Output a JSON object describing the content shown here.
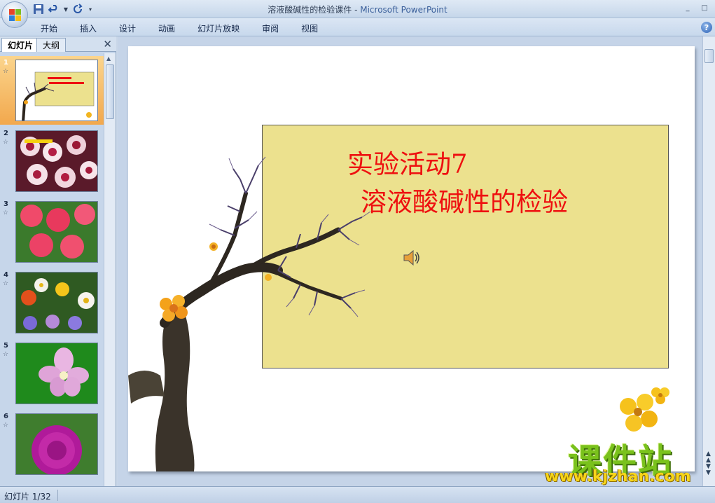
{
  "titlebar": {
    "document": "溶液酸碱性的检验课件",
    "separator": " - ",
    "app": "Microsoft PowerPoint",
    "minimize": "_",
    "maximize": "□"
  },
  "ribbon": {
    "tabs": [
      {
        "label": "开始"
      },
      {
        "label": "插入"
      },
      {
        "label": "设计"
      },
      {
        "label": "动画"
      },
      {
        "label": "幻灯片放映"
      },
      {
        "label": "审阅"
      },
      {
        "label": "视图"
      }
    ],
    "help": "?"
  },
  "left_pane": {
    "tab_slides": "幻灯片",
    "tab_outline": "大纲",
    "close": "✕",
    "thumbnails": [
      {
        "number": "1",
        "star": "☆",
        "selected": true
      },
      {
        "number": "2",
        "star": "☆",
        "selected": false
      },
      {
        "number": "3",
        "star": "☆",
        "selected": false
      },
      {
        "number": "4",
        "star": "☆",
        "selected": false
      },
      {
        "number": "5",
        "star": "☆",
        "selected": false
      },
      {
        "number": "6",
        "star": "☆",
        "selected": false
      }
    ]
  },
  "slide": {
    "title_line1": "实验活动7",
    "title_line2": "溶液酸碱性的检验"
  },
  "watermark": {
    "name": "课件站",
    "url": "www.kjzhan.com"
  },
  "statusbar": {
    "slide_info": "幻灯片 1/32"
  },
  "colors": {
    "title_red": "#ee1010",
    "textbox_fill": "#ece18e",
    "selection_orange": "#f2a84d",
    "watermark_green": "#7ac21c",
    "watermark_yellow": "#f7d51a"
  }
}
